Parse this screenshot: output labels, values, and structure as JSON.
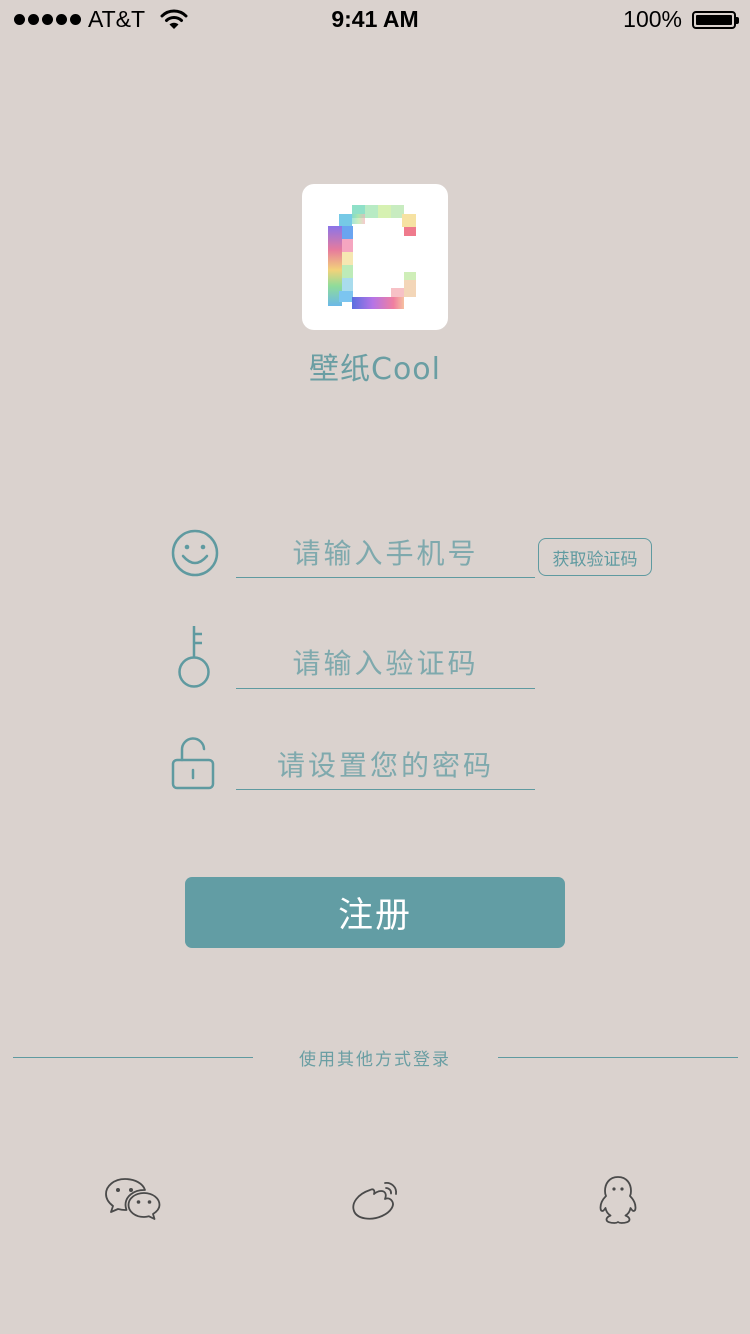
{
  "status_bar": {
    "carrier": "AT&T",
    "time": "9:41 AM",
    "battery": "100%"
  },
  "app": {
    "name": "壁纸Cool",
    "icon": "pixel-c-logo-icon"
  },
  "form": {
    "phone": {
      "placeholder": "请输入手机号",
      "value": "",
      "icon": "smiley-icon"
    },
    "get_code_label": "获取验证码",
    "code": {
      "placeholder": "请输入验证码",
      "value": "",
      "icon": "key-icon"
    },
    "password": {
      "placeholder": "请设置您的密码",
      "value": "",
      "icon": "unlock-icon"
    }
  },
  "register_label": "注册",
  "alt_login": {
    "label": "使用其他方式登录",
    "providers": [
      "wechat-icon",
      "weibo-icon",
      "qq-icon"
    ]
  },
  "colors": {
    "background": "#dad2ce",
    "accent": "#629da4",
    "text_accent": "#5f9aa0"
  }
}
